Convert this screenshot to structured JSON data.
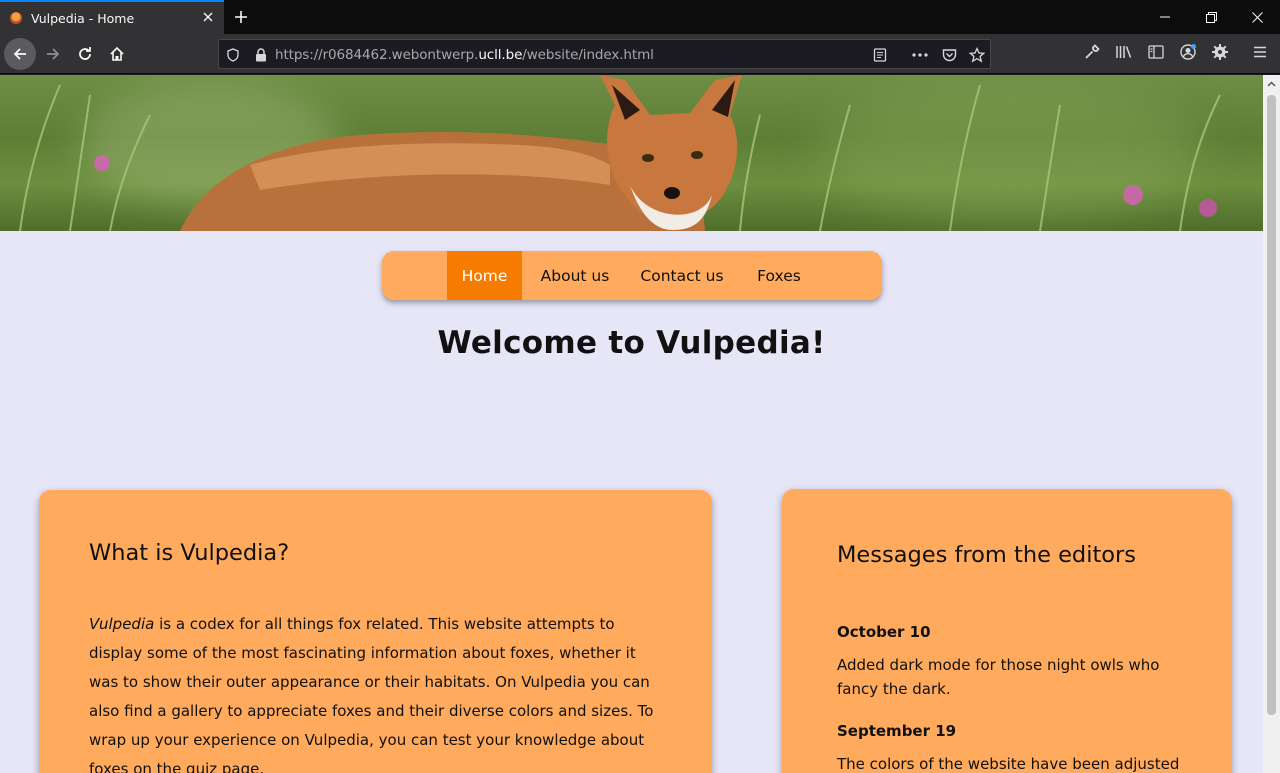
{
  "browser": {
    "tab_title": "Vulpedia - Home",
    "url_prefix": "https://r0684462.webontwerp.",
    "url_domain": "ucll.be",
    "url_path": "/website/index.html",
    "accent_color": "#0a84ff"
  },
  "page": {
    "hero_alt": "Red fox standing in grass",
    "nav": [
      {
        "label": "Home",
        "active": true
      },
      {
        "label": "About us",
        "active": false
      },
      {
        "label": "Contact us",
        "active": false
      },
      {
        "label": "Foxes",
        "active": false
      }
    ],
    "welcome": "Welcome to Vulpedia!",
    "about": {
      "heading": "What is Vulpedia?",
      "brand": "Vulpedia",
      "text": " is a codex for all things fox related. This website attempts to display some of the most fascinating information about foxes, whether it was to show their outer appearance or their habitats. On Vulpedia you can also find a gallery to appreciate foxes and their diverse colors and sizes. To wrap up your experience on Vulpedia, you can test your knowledge about foxes on the quiz page."
    },
    "messages": {
      "heading": "Messages from the editors",
      "items": [
        {
          "date": "October 10",
          "text": "Added dark mode for those night owls who fancy the dark."
        },
        {
          "date": "September 19",
          "text": "The colors of the website have been adjusted to"
        }
      ]
    },
    "colors": {
      "background": "#e6e6f7",
      "card": "#ffaa5c",
      "nav_active": "#f57c00"
    }
  }
}
